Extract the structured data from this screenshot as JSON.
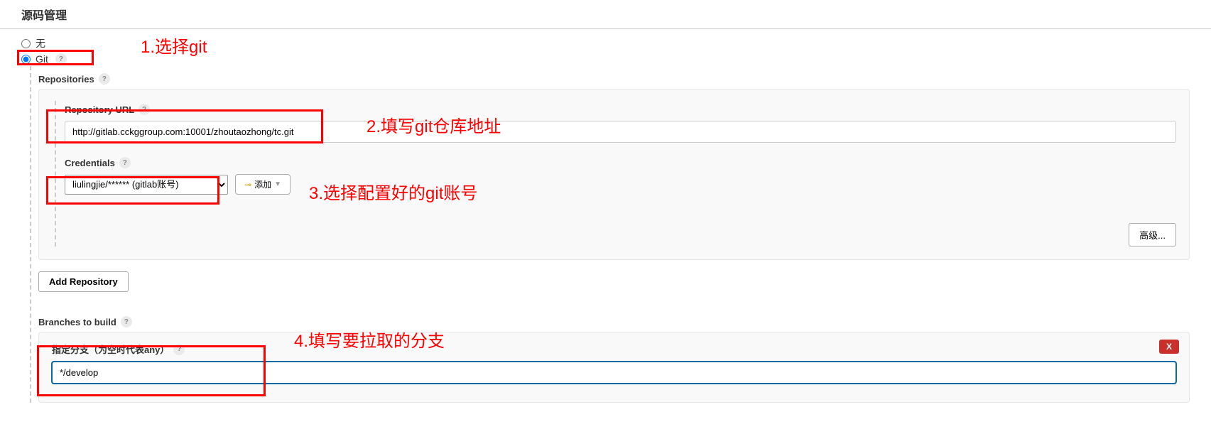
{
  "section": {
    "title": "源码管理"
  },
  "scm_options": {
    "none_label": "无",
    "git_label": "Git"
  },
  "repositories": {
    "label": "Repositories",
    "url_label": "Repository URL",
    "url_value": "http://gitlab.cckggroup.com:10001/zhoutaozhong/tc.git",
    "credentials_label": "Credentials",
    "credentials_selected": "liulingjie/****** (gitlab账号)",
    "add_button": "添加",
    "advanced_button": "高级...",
    "add_repo_button": "Add Repository"
  },
  "branches": {
    "label": "Branches to build",
    "branch_spec_label": "指定分支（为空时代表any）",
    "branch_value": "*/develop",
    "delete_btn": "X"
  },
  "annotations": {
    "a1": "1.选择git",
    "a2": "2.填写git仓库地址",
    "a3": "3.选择配置好的git账号",
    "a4": "4.填写要拉取的分支"
  }
}
